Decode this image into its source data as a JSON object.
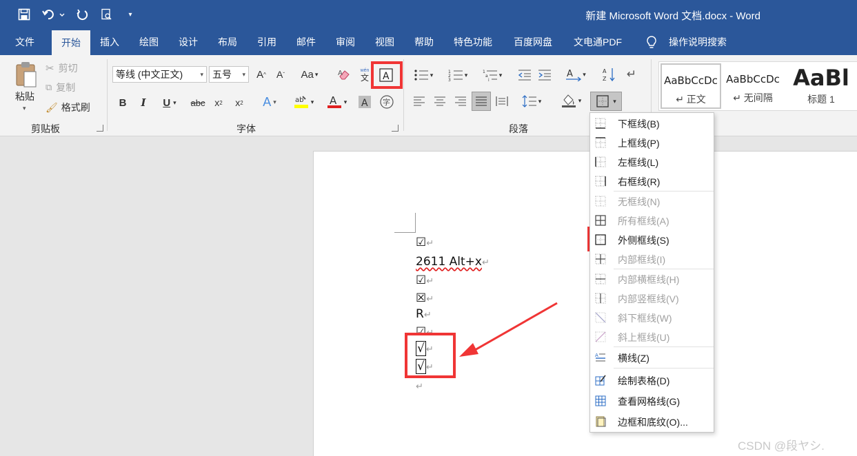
{
  "window": {
    "title": "新建 Microsoft Word 文档.docx  -  Word"
  },
  "tabs": [
    "文件",
    "开始",
    "插入",
    "绘图",
    "设计",
    "布局",
    "引用",
    "邮件",
    "审阅",
    "视图",
    "帮助",
    "特色功能",
    "百度网盘",
    "文电通PDF",
    "操作说明搜索"
  ],
  "clipboard": {
    "paste": "粘贴",
    "cut": "剪切",
    "copy": "复制",
    "format_painter": "格式刷",
    "group_label": "剪贴板"
  },
  "font": {
    "family": "等线 (中文正文)",
    "size": "五号",
    "group_label": "字体"
  },
  "paragraph": {
    "group_label": "段落"
  },
  "styles": [
    {
      "sample": "AaBbCcDc",
      "name": "↵ 正文"
    },
    {
      "sample": "AaBbCcDc",
      "name": "↵ 无间隔"
    },
    {
      "sample": "AaBl",
      "name": "标题 1"
    }
  ],
  "document": {
    "lines": [
      "☑",
      "2611 Alt+x",
      "☑",
      "☒",
      "R",
      "☑",
      "√",
      "√",
      ""
    ],
    "para_mark": "↵"
  },
  "border_menu": {
    "items": [
      {
        "label": "下框线(B)",
        "icon": "bottom-border-icon",
        "disabled": false
      },
      {
        "label": "上框线(P)",
        "icon": "top-border-icon",
        "disabled": false
      },
      {
        "label": "左框线(L)",
        "icon": "left-border-icon",
        "disabled": false
      },
      {
        "label": "右框线(R)",
        "icon": "right-border-icon",
        "disabled": false
      },
      {
        "label": "无框线(N)",
        "icon": "no-border-icon",
        "disabled": true
      },
      {
        "label": "所有框线(A)",
        "icon": "all-borders-icon",
        "disabled": true
      },
      {
        "label": "外侧框线(S)",
        "icon": "outside-borders-icon",
        "disabled": false
      },
      {
        "label": "内部框线(I)",
        "icon": "inside-borders-icon",
        "disabled": true
      },
      {
        "label": "内部横框线(H)",
        "icon": "inside-horizontal-border-icon",
        "disabled": true
      },
      {
        "label": "内部竖框线(V)",
        "icon": "inside-vertical-border-icon",
        "disabled": true
      },
      {
        "label": "斜下框线(W)",
        "icon": "diagonal-down-border-icon",
        "disabled": true
      },
      {
        "label": "斜上框线(U)",
        "icon": "diagonal-up-border-icon",
        "disabled": true
      },
      {
        "label": "横线(Z)",
        "icon": "horizontal-line-icon",
        "disabled": false
      },
      {
        "label": "绘制表格(D)",
        "icon": "draw-table-icon",
        "disabled": false
      },
      {
        "label": "查看网格线(G)",
        "icon": "view-gridlines-icon",
        "disabled": false
      },
      {
        "label": "边框和底纹(O)...",
        "icon": "borders-shading-icon",
        "disabled": false
      }
    ]
  },
  "watermark": "CSDN @段ヤシ.",
  "colors": {
    "titlebar": "#2b579a",
    "highlight": "#f03535",
    "font_color": "#e02020",
    "highlight_color": "#ffff00"
  }
}
